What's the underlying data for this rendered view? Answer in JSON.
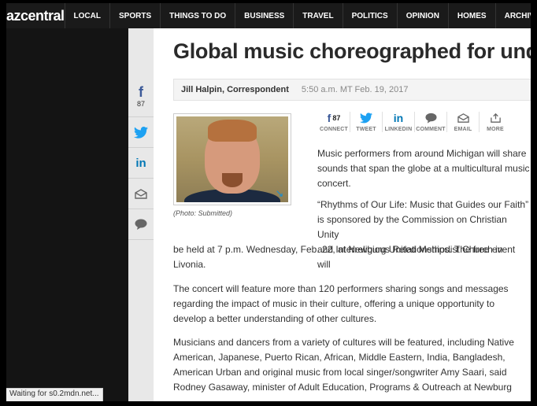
{
  "nav": {
    "logo_a": "az",
    "logo_b": "central",
    "items": [
      "LOCAL",
      "SPORTS",
      "THINGS TO DO",
      "BUSINESS",
      "TRAVEL",
      "POLITICS",
      "OPINION",
      "HOMES",
      "ARCHIVES"
    ]
  },
  "rail": {
    "facebook_count": "87",
    "icons": [
      "facebook-icon",
      "twitter-icon",
      "linkedin-icon",
      "email-icon",
      "comment-icon"
    ]
  },
  "article": {
    "headline": "Global music choreographed for und",
    "author": "Jill Halpin, Correspondent",
    "date": "5:50 a.m. MT Feb. 19, 2017",
    "caption": "(Photo: Submitted)",
    "share": {
      "facebook_count": "87",
      "connect": "CONNECT",
      "tweet": "TWEET",
      "linkedin": "LINKEDIN",
      "comment": "COMMENT",
      "email": "EMAIL",
      "more": "MORE"
    },
    "p1_lines": [
      "Music performers from around Michigan will share",
      "sounds that span the globe at a multicultural music",
      "concert."
    ],
    "p2_lines_narrow": [
      "“Rhythms of Our Life: Music that Guides our Faith”",
      "is sponsored by the Commission on Christian Unity",
      "and Interreligious Relationships. The free event will"
    ],
    "p2_lines_wide": [
      "be held at 7 p.m. Wednesday, Feb. 22, at Newburg United Methodist Church in",
      "Livonia."
    ],
    "p3_lines": [
      "The concert will feature more than 120 performers sharing songs and messages",
      "regarding the impact of music in their culture, offering a unique opportunity to",
      "develop a better understanding of other cultures."
    ],
    "p4_lines": [
      "Musicians and dancers from a variety of cultures will be featured, including Native",
      "American, Japanese, Puerto Rican, African, Middle Eastern, India, Bangladesh,",
      "American Urban and original music from local singer/songwriter Amy Saari, said",
      "Rodney Gasaway, minister of Adult Education, Programs & Outreach at Newburg"
    ]
  },
  "status_text": "Waiting for s0.2mdn.net...",
  "colors": {
    "nav_bg": "#1a1a1a",
    "facebook": "#3b5998",
    "twitter": "#1da1f2",
    "linkedin": "#0077b5"
  }
}
